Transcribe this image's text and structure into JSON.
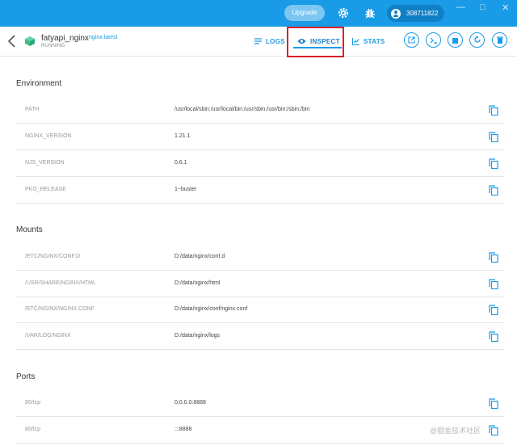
{
  "titlebar": {
    "upgrade_label": "Upgrade",
    "account_name": "308711822",
    "settings_icon": "gear-icon",
    "bug_icon": "bug-icon",
    "accent": "#1a9be8"
  },
  "container": {
    "name": "fatyapi_nginx",
    "image": "nginx:latest",
    "status": "RUNNING"
  },
  "tabs": [
    {
      "label": "LOGS",
      "icon": "list-icon"
    },
    {
      "label": "INSPECT",
      "icon": "eye-icon"
    },
    {
      "label": "STATS",
      "icon": "chart-icon"
    }
  ],
  "actions": [
    "open-external-icon",
    "terminal-icon",
    "stop-icon",
    "restart-icon",
    "delete-icon"
  ],
  "sections": {
    "environment": {
      "title": "Environment",
      "rows": [
        {
          "key": "PATH",
          "value": "/usr/local/sbin:/usr/local/bin:/usr/sbin:/usr/bin:/sbin:/bin"
        },
        {
          "key": "NGINX_VERSION",
          "value": "1.21.1"
        },
        {
          "key": "NJS_VERSION",
          "value": "0.6.1"
        },
        {
          "key": "PKG_RELEASE",
          "value": "1~buster"
        }
      ]
    },
    "mounts": {
      "title": "Mounts",
      "rows": [
        {
          "key": "/ETC/NGINX/CONF.D",
          "value": "D:/data/nginx/conf.d"
        },
        {
          "key": "/USR/SHARE/NGINX/HTML",
          "value": "D:/data/nginx/html"
        },
        {
          "key": "/ETC/NGINX/NGINX.CONF",
          "value": "D:/data/nginx/conf/nginx.conf"
        },
        {
          "key": "/VAR/LOG/NGINX",
          "value": "D:/data/nginx/logs"
        }
      ]
    },
    "ports": {
      "title": "Ports",
      "rows": [
        {
          "key": "80/tcp",
          "value": "0.0.0.0:8888"
        },
        {
          "key": "80/tcp",
          "value": ":::8888"
        }
      ]
    }
  },
  "watermark": "@掘金技术社区"
}
